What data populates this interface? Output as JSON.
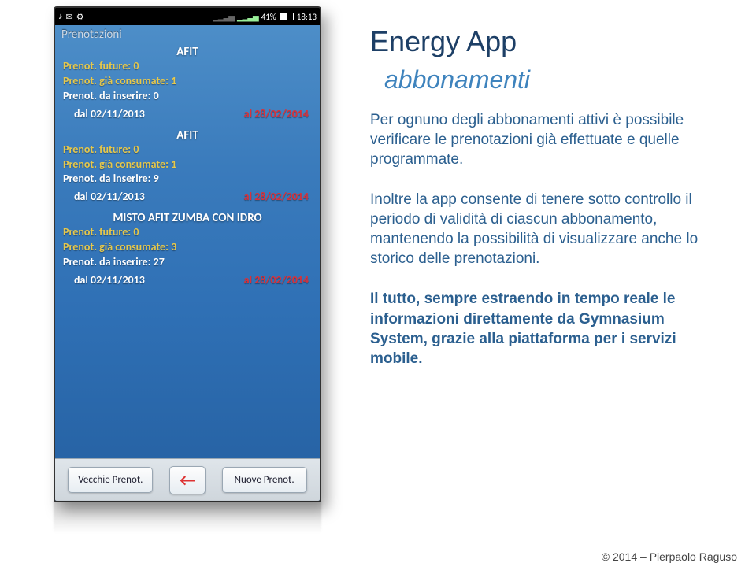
{
  "status": {
    "battery": "41%",
    "time": "18:13"
  },
  "app": {
    "header": "Prenotazioni",
    "groups": [
      {
        "title": "AFIT",
        "future": {
          "label": "Prenot. future:",
          "value": "0"
        },
        "consumed": {
          "label": "Prenot. già consumate:",
          "value": "1"
        },
        "toinsert": {
          "label": "Prenot. da inserire:",
          "value": "0"
        },
        "from": {
          "label": "dal",
          "value": "02/11/2013"
        },
        "to": {
          "label": "al",
          "value": "28/02/2014"
        }
      },
      {
        "title": "AFIT",
        "future": {
          "label": "Prenot. future:",
          "value": "0"
        },
        "consumed": {
          "label": "Prenot. già consumate:",
          "value": "1"
        },
        "toinsert": {
          "label": "Prenot. da inserire:",
          "value": "9"
        },
        "from": {
          "label": "dal",
          "value": "02/11/2013"
        },
        "to": {
          "label": "al",
          "value": "28/02/2014"
        }
      },
      {
        "title": "MISTO AFIT ZUMBA CON IDRO",
        "future": {
          "label": "Prenot. future:",
          "value": "0"
        },
        "consumed": {
          "label": "Prenot. già consumate:",
          "value": "3"
        },
        "toinsert": {
          "label": "Prenot. da inserire:",
          "value": "27"
        },
        "from": {
          "label": "dal",
          "value": "02/11/2013"
        },
        "to": {
          "label": "al",
          "value": "28/02/2014"
        }
      }
    ],
    "btn_old": "Vecchie Prenot.",
    "btn_new": "Nuove Prenot."
  },
  "slide": {
    "title": "Energy App",
    "subtitle": "abbonamenti",
    "p1": "Per ognuno degli abbonamenti attivi è possibile verificare le prenotazioni già effettuate e quelle programmate.",
    "p2": "Inoltre la app consente di tenere sotto controllo il periodo di validità di ciascun abbonamento, mantenendo la possibilità di visualizzare anche lo storico delle prenotazioni.",
    "p3": "Il tutto, sempre estraendo in tempo reale le informazioni direttamente da Gymnasium System, grazie alla piattaforma per i servizi mobile."
  },
  "footer": "© 2014 – Pierpaolo Raguso"
}
